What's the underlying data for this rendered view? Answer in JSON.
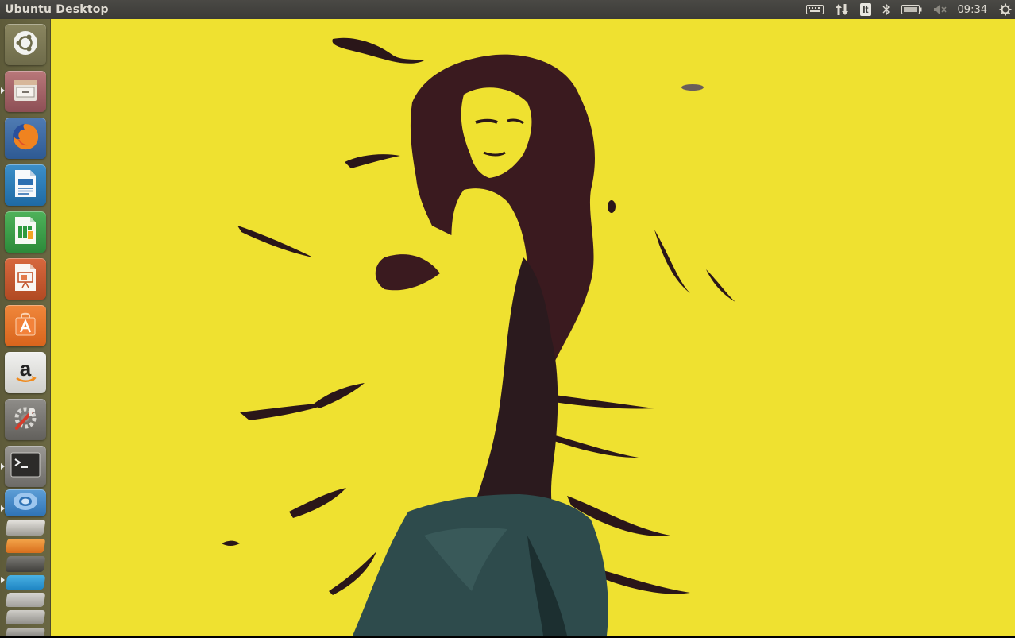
{
  "topbar": {
    "title": "Ubuntu Desktop",
    "keyboard_layout": "It",
    "clock": "09:34",
    "icons": [
      "keyboard-icon",
      "network-icon",
      "keyboard-layout-indicator",
      "bluetooth-icon",
      "battery-icon",
      "volume-muted-icon",
      "session-gear-icon"
    ]
  },
  "launcher": {
    "items": [
      {
        "name": "dash-home",
        "icon": "ubuntu-logo-icon"
      },
      {
        "name": "files",
        "icon": "file-cabinet-icon",
        "running": true
      },
      {
        "name": "firefox",
        "icon": "firefox-icon"
      },
      {
        "name": "libreoffice-writer",
        "icon": "writer-document-icon"
      },
      {
        "name": "libreoffice-calc",
        "icon": "calc-spreadsheet-icon"
      },
      {
        "name": "libreoffice-impress",
        "icon": "impress-presentation-icon"
      },
      {
        "name": "ubuntu-software-center",
        "icon": "software-bag-icon"
      },
      {
        "name": "amazon",
        "icon": "amazon-icon"
      },
      {
        "name": "system-settings",
        "icon": "settings-wrench-icon"
      },
      {
        "name": "terminal",
        "icon": "terminal-icon",
        "running": true
      },
      {
        "name": "chromium",
        "icon": "chromium-icon",
        "running": true
      },
      {
        "name": "stacked-apps",
        "icon": "stacked-launcher-icons"
      }
    ]
  },
  "desktop": {
    "wallpaper": "yellow ink-splatter portrait of a woman",
    "background_color": "#efe130"
  }
}
